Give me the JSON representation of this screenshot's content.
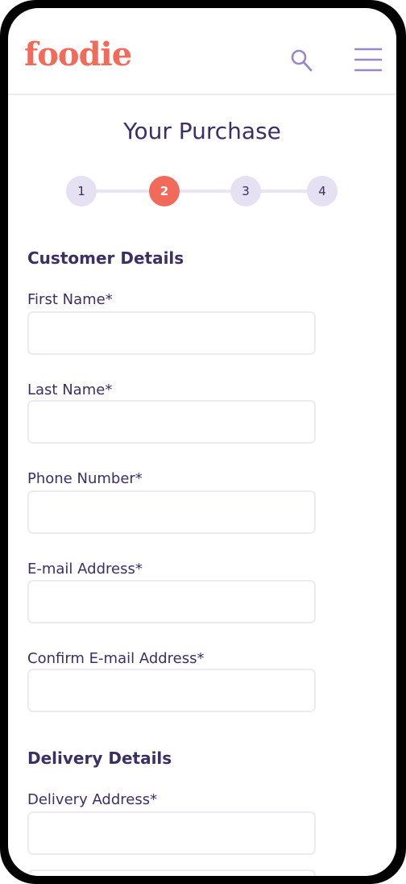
{
  "header": {
    "logo": "foodie",
    "search_icon": "search-icon",
    "menu_icon": "hamburger-menu-icon"
  },
  "page": {
    "title": "Your Purchase"
  },
  "stepper": {
    "steps": [
      "1",
      "2",
      "3",
      "4"
    ],
    "current": "2"
  },
  "customer": {
    "title": "Customer Details",
    "fields": {
      "first_name": {
        "label": "First Name*",
        "value": ""
      },
      "last_name": {
        "label": "Last Name*",
        "value": ""
      },
      "phone": {
        "label": "Phone Number*",
        "value": ""
      },
      "email": {
        "label": "E-mail Address*",
        "value": ""
      },
      "confirm_email": {
        "label": "Confirm E-mail Address*",
        "value": ""
      }
    }
  },
  "delivery": {
    "title": "Delivery Details",
    "fields": {
      "address": {
        "label": "Delivery Address*",
        "value": ""
      },
      "address_line2": {
        "value": ""
      }
    }
  },
  "colors": {
    "brand": "#f26a5a",
    "text": "#3b2f63",
    "icon": "#9b86c8",
    "step_inactive": "#e6e0f3",
    "border": "#ecebf3"
  }
}
